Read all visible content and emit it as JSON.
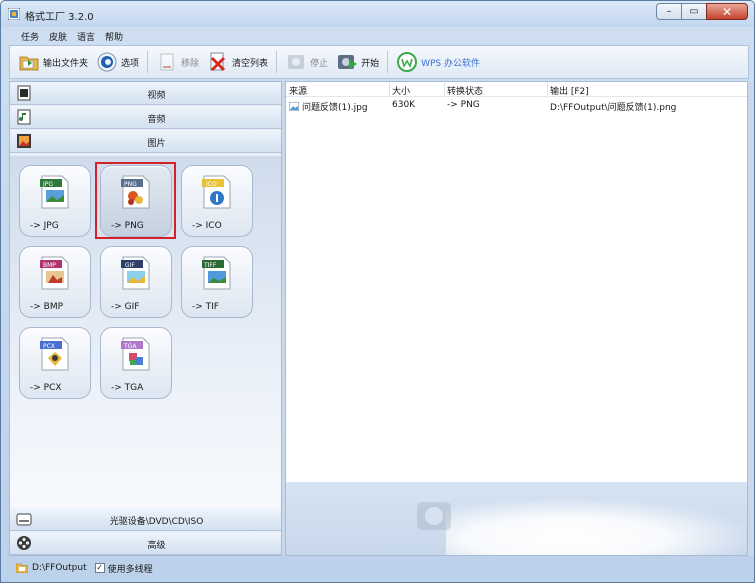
{
  "window": {
    "title": "格式工厂 3.2.0",
    "minimize_glyph": "–",
    "maximize_glyph": "▭",
    "close_glyph": "✕"
  },
  "menu": [
    "任务",
    "皮肤",
    "语言",
    "帮助"
  ],
  "toolbar": {
    "output_folder": "输出文件夹",
    "options": "选项",
    "remove": "移除",
    "clear_list": "清空列表",
    "stop": "停止",
    "start": "开始",
    "wps": "WPS 办公软件"
  },
  "categories": {
    "video": "视频",
    "audio": "音频",
    "image": "图片",
    "optical": "光驱设备\\DVD\\CD\\ISO",
    "advanced": "高级"
  },
  "tiles": [
    {
      "badge": "JPG",
      "label": "-> JPG",
      "badge_color": "#2e7a3a",
      "selected": false
    },
    {
      "badge": "PNG",
      "label": "-> PNG",
      "badge_color": "#5a6f8c",
      "selected": true
    },
    {
      "badge": "ICO",
      "label": "-> ICO",
      "badge_color": "#e7c338",
      "selected": false
    },
    {
      "badge": "BMP",
      "label": "-> BMP",
      "badge_color": "#b0356e",
      "selected": false
    },
    {
      "badge": "GIF",
      "label": "-> GIF",
      "badge_color": "#2f3f6a",
      "selected": false
    },
    {
      "badge": "TIFF",
      "label": "-> TIF",
      "badge_color": "#2b6a33",
      "selected": false
    },
    {
      "badge": "PCX",
      "label": "-> PCX",
      "badge_color": "#4a6fd0",
      "selected": false
    },
    {
      "badge": "TGA",
      "label": "-> TGA",
      "badge_color": "#b078c8",
      "selected": false
    }
  ],
  "table": {
    "headers": [
      "来源",
      "大小",
      "转换状态",
      "输出 [F2]"
    ],
    "rows": [
      {
        "source": "问题反馈(1).jpg",
        "size": "630K",
        "status": "-> PNG",
        "output": "D:\\FFOutput\\问题反馈(1).png"
      }
    ]
  },
  "status": {
    "output_path": "D:\\FFOutput",
    "multithread_label": "使用多线程",
    "multithread_checked": true,
    "check_glyph": "✓"
  },
  "colors": {
    "selection_outline": "#d4202a",
    "wps_text": "#3b6fd0"
  }
}
